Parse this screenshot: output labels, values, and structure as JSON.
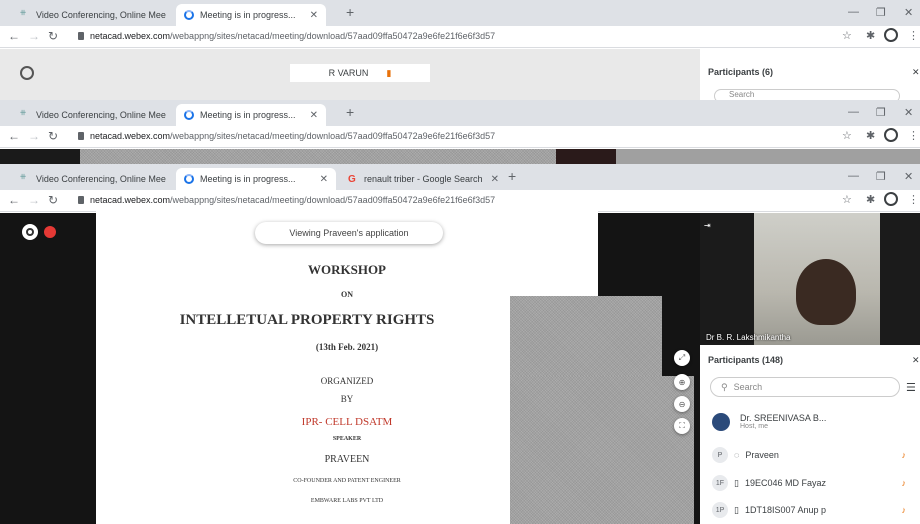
{
  "windows": [
    {
      "tabs": [
        {
          "title": "Video Conferencing, Online Mee",
          "active": false
        },
        {
          "title": "Meeting is in progress...",
          "active": true
        }
      ],
      "url_domain": "netacad.webex.com",
      "url_path": "/webappng/sites/netacad/meeting/download/57aad09ffa50472a9e6fe21f6e6f3d57",
      "presenter_name": "R VARUN",
      "panel_title": "Participants (6)",
      "search_placeholder": "Search"
    },
    {
      "tabs": [
        {
          "title": "Video Conferencing, Online Mee",
          "active": false
        },
        {
          "title": "Meeting is in progress...",
          "active": true
        }
      ],
      "url_domain": "netacad.webex.com",
      "url_path": "/webappng/sites/netacad/meeting/download/57aad09ffa50472a9e6fe21f6e6f3d57"
    },
    {
      "tabs": [
        {
          "title": "Video Conferencing, Online Mee",
          "active": false
        },
        {
          "title": "Meeting is in progress...",
          "active": true
        },
        {
          "title": "renault triber - Google Search",
          "active": false
        }
      ],
      "url_domain": "netacad.webex.com",
      "url_path": "/webappng/sites/netacad/meeting/download/57aad09ffa50472a9e6fe21f6e6f3d57"
    }
  ],
  "share_banner": "Viewing Praveen's application",
  "slide": {
    "title1": "WORKSHOP",
    "title2": "ON",
    "title3": "INTELLETUAL PROPERTY RIGHTS",
    "date": "(13th Feb. 2021)",
    "organized": "ORGANIZED",
    "by": "BY",
    "org": "IPR- CELL DSATM",
    "speaker_label": "SPEAKER",
    "speaker": "PRAVEEN",
    "role": "CO-FOUNDER AND PATENT ENGINEER",
    "company": "EMBWARE LABS PVT LTD"
  },
  "video_label": "Dr B. R. Lakshmikantha",
  "participants_title": "Participants (148)",
  "search_placeholder": "Search",
  "participants": [
    {
      "initials": "",
      "name": "Dr. SREENIVASA B...",
      "sub": "Host, me"
    },
    {
      "initials": "P",
      "name": "Praveen",
      "sub": ""
    },
    {
      "initials": "1F",
      "name": "19EC046 MD Fayaz",
      "sub": ""
    },
    {
      "initials": "1P",
      "name": "1DT18IS007 Anup p",
      "sub": ""
    }
  ],
  "colors": {
    "accent": "#1a73e8",
    "mic": "#e8710a",
    "org_red": "#c0392b"
  }
}
